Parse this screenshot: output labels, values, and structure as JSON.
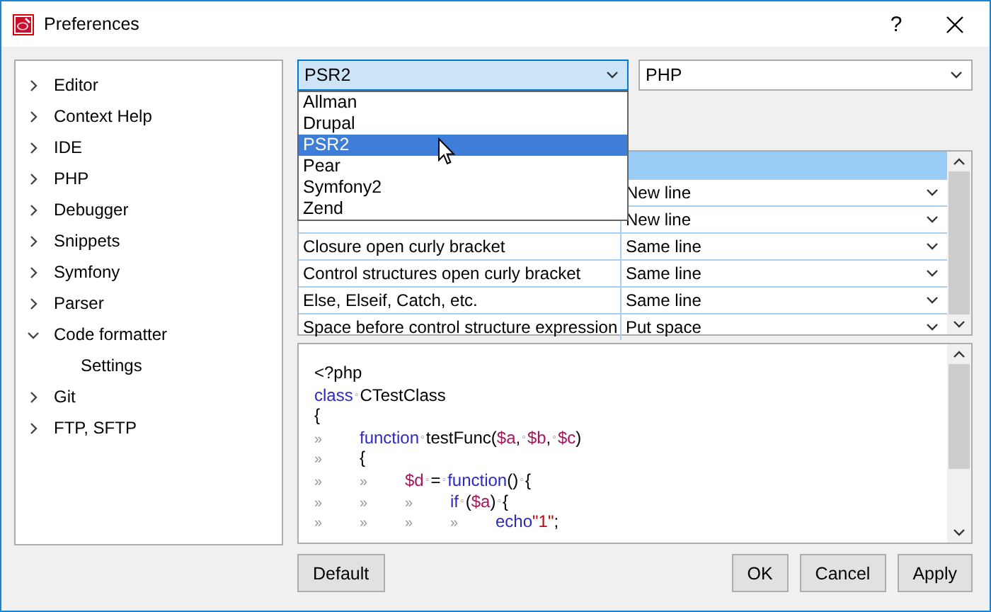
{
  "window": {
    "title": "Preferences",
    "help": "?"
  },
  "tree": [
    {
      "label": "Editor",
      "expanded": false
    },
    {
      "label": "Context Help",
      "expanded": false
    },
    {
      "label": "IDE",
      "expanded": false
    },
    {
      "label": "PHP",
      "expanded": false
    },
    {
      "label": "Debugger",
      "expanded": false
    },
    {
      "label": "Snippets",
      "expanded": false
    },
    {
      "label": "Symfony",
      "expanded": false
    },
    {
      "label": "Parser",
      "expanded": false
    },
    {
      "label": "Code formatter",
      "expanded": true,
      "children": [
        {
          "label": "Settings"
        }
      ]
    },
    {
      "label": "Git",
      "expanded": false
    },
    {
      "label": "FTP, SFTP",
      "expanded": false
    }
  ],
  "profile_select": {
    "value": "PSR2",
    "open": true,
    "options": [
      {
        "label": "Allman",
        "selected": false
      },
      {
        "label": "Drupal",
        "selected": false
      },
      {
        "label": "PSR2",
        "selected": true
      },
      {
        "label": "Pear",
        "selected": false
      },
      {
        "label": "Symfony2",
        "selected": false
      },
      {
        "label": "Zend",
        "selected": false
      }
    ]
  },
  "language_select": {
    "value": "PHP"
  },
  "table": {
    "rows": [
      {
        "value": "New line"
      },
      {
        "value": "New line"
      },
      {
        "label": "Closure open curly bracket",
        "value": "Same line"
      },
      {
        "label": "Control structures open curly bracket",
        "value": "Same line"
      },
      {
        "label": "Else, Elseif, Catch, etc.",
        "value": "Same line"
      },
      {
        "label": "Space before control structure expression",
        "value": "Put space"
      }
    ]
  },
  "code_preview": [
    [
      {
        "kind": "plain",
        "text": "<?php"
      }
    ],
    [
      {
        "kind": "keyword",
        "text": "class"
      },
      {
        "kind": "space",
        "text": "◦"
      },
      {
        "kind": "plain",
        "text": "CTestClass"
      }
    ],
    [
      {
        "kind": "plain",
        "text": "{"
      }
    ],
    [
      {
        "kind": "tab",
        "text": "»"
      },
      {
        "kind": "keyword",
        "text": "function"
      },
      {
        "kind": "space",
        "text": "◦"
      },
      {
        "kind": "plain",
        "text": "testFunc("
      },
      {
        "kind": "variable",
        "text": "$a"
      },
      {
        "kind": "plain",
        "text": ","
      },
      {
        "kind": "space",
        "text": "◦"
      },
      {
        "kind": "variable",
        "text": "$b"
      },
      {
        "kind": "plain",
        "text": ","
      },
      {
        "kind": "space",
        "text": "◦"
      },
      {
        "kind": "variable",
        "text": "$c"
      },
      {
        "kind": "plain",
        "text": ")"
      }
    ],
    [
      {
        "kind": "tab",
        "text": "»"
      },
      {
        "kind": "plain",
        "text": "{"
      }
    ],
    [
      {
        "kind": "tab",
        "text": "»"
      },
      {
        "kind": "tab",
        "text": "»"
      },
      {
        "kind": "variable",
        "text": "$d"
      },
      {
        "kind": "space",
        "text": "◦"
      },
      {
        "kind": "plain",
        "text": "="
      },
      {
        "kind": "space",
        "text": "◦"
      },
      {
        "kind": "keyword",
        "text": "function"
      },
      {
        "kind": "plain",
        "text": "()"
      },
      {
        "kind": "space",
        "text": "◦"
      },
      {
        "kind": "plain",
        "text": "{"
      }
    ],
    [
      {
        "kind": "tab",
        "text": "»"
      },
      {
        "kind": "tab",
        "text": "»"
      },
      {
        "kind": "tab",
        "text": "»"
      },
      {
        "kind": "keyword",
        "text": "if"
      },
      {
        "kind": "space",
        "text": "◦"
      },
      {
        "kind": "plain",
        "text": "("
      },
      {
        "kind": "variable",
        "text": "$a"
      },
      {
        "kind": "plain",
        "text": ")"
      },
      {
        "kind": "space",
        "text": "◦"
      },
      {
        "kind": "plain",
        "text": "{"
      }
    ],
    [
      {
        "kind": "tab",
        "text": "»"
      },
      {
        "kind": "tab",
        "text": "»"
      },
      {
        "kind": "tab",
        "text": "»"
      },
      {
        "kind": "tab",
        "text": "»"
      },
      {
        "kind": "keyword",
        "text": "echo"
      },
      {
        "kind": "string",
        "text": "\"1\""
      },
      {
        "kind": "plain",
        "text": ";"
      }
    ]
  ],
  "buttons": {
    "left": [
      "Default"
    ],
    "right": [
      "OK",
      "Cancel",
      "Apply"
    ]
  }
}
